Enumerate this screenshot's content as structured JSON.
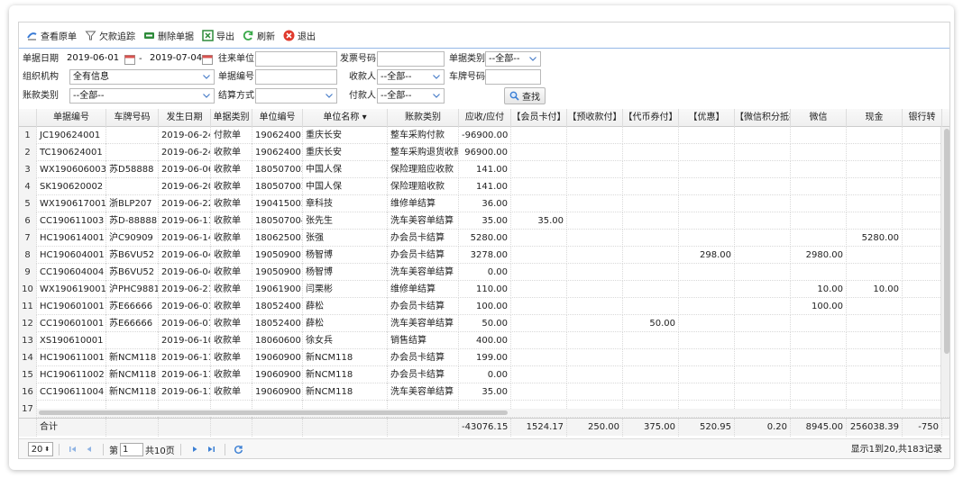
{
  "toolbar": {
    "view": "查看原单",
    "trace": "欠款追踪",
    "delete": "删除单据",
    "export": "导出",
    "refresh": "刷新",
    "exit": "退出"
  },
  "filters": {
    "date_label": "单据日期",
    "date_from": "2019-06-01",
    "date_sep": "-",
    "date_to": "2019-07-04",
    "partner_label": "往来单位",
    "partner_value": "",
    "invoice_label": "发票号码",
    "invoice_value": "",
    "doc_type_label": "单据类别",
    "doc_type_value": "--全部--",
    "org_label": "组织机构",
    "org_value": "全有信息",
    "doc_no_label": "单据编号",
    "doc_no_value": "",
    "payee_label": "收款人",
    "payee_value": "--全部--",
    "plate_label": "车牌号码",
    "plate_value": "",
    "acct_type_label": "账款类别",
    "acct_type_value": "--全部--",
    "settle_label": "结算方式",
    "settle_value": "",
    "payer_label": "付款人",
    "payer_value": "--全部--",
    "search_label": "查找"
  },
  "table": {
    "headers": [
      "单据编号",
      "车牌号码",
      "发生日期",
      "单据类别",
      "单位编号",
      "单位名称 ▾",
      "账款类别",
      "应收/应付",
      "【会员卡付】",
      "【预收款付】",
      "【代币券付】",
      "【优惠】",
      "【微信积分抵扣",
      "微信",
      "现金",
      "银行转"
    ],
    "rows": [
      [
        "1",
        "JC190624001",
        "",
        "2019-06-24",
        "付款单",
        "190624001",
        "重庆长安",
        "整车采购付款",
        "-96900.00",
        "",
        "",
        "",
        "",
        "",
        "",
        "",
        ""
      ],
      [
        "2",
        "TC190624001",
        "",
        "2019-06-24",
        "收款单",
        "190624001",
        "重庆长安",
        "整车采购退货收款",
        "96900.00",
        "",
        "",
        "",
        "",
        "",
        "",
        "",
        ""
      ],
      [
        "3",
        "WX190606003-B",
        "苏D58888",
        "2019-06-06",
        "收款单",
        "180507002",
        "中国人保",
        "保险理赔应收款",
        "141.00",
        "",
        "",
        "",
        "",
        "",
        "",
        "",
        ""
      ],
      [
        "4",
        "SK190620002",
        "",
        "2019-06-20",
        "收款单",
        "180507002",
        "中国人保",
        "保险理赔收款",
        "141.00",
        "",
        "",
        "",
        "",
        "",
        "",
        "",
        ""
      ],
      [
        "5",
        "WX190617001",
        "浙BLP207",
        "2019-06-22",
        "收款单",
        "190415002",
        "章科技",
        "维修单结算",
        "36.00",
        "",
        "",
        "",
        "",
        "",
        "",
        "",
        ""
      ],
      [
        "6",
        "CC190611003",
        "苏D-88888",
        "2019-06-11",
        "收款单",
        "180507004",
        "张先生",
        "洗车美容单结算",
        "35.00",
        "35.00",
        "",
        "",
        "",
        "",
        "",
        "",
        ""
      ],
      [
        "7",
        "HC190614001",
        "沪C90909",
        "2019-06-14",
        "收款单",
        "180625003",
        "张强",
        "办会员卡结算",
        "5280.00",
        "",
        "",
        "",
        "",
        "",
        "",
        "5280.00",
        ""
      ],
      [
        "8",
        "HC190604001",
        "苏B6VU52",
        "2019-06-04",
        "收款单",
        "190509001",
        "杨智博",
        "办会员卡结算",
        "3278.00",
        "",
        "",
        "",
        "298.00",
        "",
        "2980.00",
        "",
        ""
      ],
      [
        "9",
        "CC190604004",
        "苏B6VU52",
        "2019-06-04",
        "收款单",
        "190509001",
        "杨智博",
        "洗车美容单结算",
        "0.00",
        "",
        "",
        "",
        "",
        "",
        "",
        "",
        ""
      ],
      [
        "10",
        "WX190619001",
        "沪PHC9881",
        "2019-06-21",
        "收款单",
        "190619001",
        "闫栗彬",
        "维修单结算",
        "110.00",
        "",
        "",
        "",
        "",
        "",
        "10.00",
        "10.00",
        ""
      ],
      [
        "11",
        "HC190601001",
        "苏E66666",
        "2019-06-01",
        "收款单",
        "180524001",
        "薛松",
        "办会员卡结算",
        "100.00",
        "",
        "",
        "",
        "",
        "",
        "100.00",
        "",
        ""
      ],
      [
        "12",
        "CC190601001",
        "苏E66666",
        "2019-06-01",
        "收款单",
        "180524001",
        "薛松",
        "洗车美容单结算",
        "50.00",
        "",
        "",
        "50.00",
        "",
        "",
        "",
        "",
        ""
      ],
      [
        "13",
        "XS190610001",
        "",
        "2019-06-10",
        "收款单",
        "180606001",
        "徐女兵",
        "销售结算",
        "400.00",
        "",
        "",
        "",
        "",
        "",
        "",
        "",
        ""
      ],
      [
        "14",
        "HC190611001",
        "新NCM118",
        "2019-06-11",
        "收款单",
        "190609001",
        "新NCM118",
        "办会员卡结算",
        "199.00",
        "",
        "",
        "",
        "",
        "",
        "",
        "",
        ""
      ],
      [
        "15",
        "HC190611002",
        "新NCM118",
        "2019-06-11",
        "收款单",
        "190609001",
        "新NCM118",
        "办会员卡结算",
        "0.00",
        "",
        "",
        "",
        "",
        "",
        "",
        "",
        ""
      ],
      [
        "16",
        "CC190611004",
        "新NCM118",
        "2019-06-11",
        "收款单",
        "190609001",
        "新NCM118",
        "洗车美容单结算",
        "35.00",
        "",
        "",
        "",
        "",
        "",
        "",
        "",
        ""
      ],
      [
        "17",
        "",
        "",
        "",
        "",
        "",
        "",
        "",
        "",
        "",
        "",
        "",
        "",
        "",
        "",
        "",
        ""
      ]
    ],
    "footer": [
      "",
      "合计",
      "",
      "",
      "",
      "",
      "",
      "",
      "-43076.15",
      "1524.17",
      "250.00",
      "375.00",
      "520.95",
      "0.20",
      "8945.00",
      "256038.39",
      "-750"
    ]
  },
  "pager": {
    "page_size": "20",
    "page_label": "第",
    "page_value": "1",
    "total_pages": "共10页",
    "info": "显示1到20,共183记录"
  },
  "colors": {
    "accent": "#95b8e7",
    "exit_red": "#e03b2e",
    "export_green": "#2e8b3a",
    "pager_blue": "#3b7fd4"
  }
}
